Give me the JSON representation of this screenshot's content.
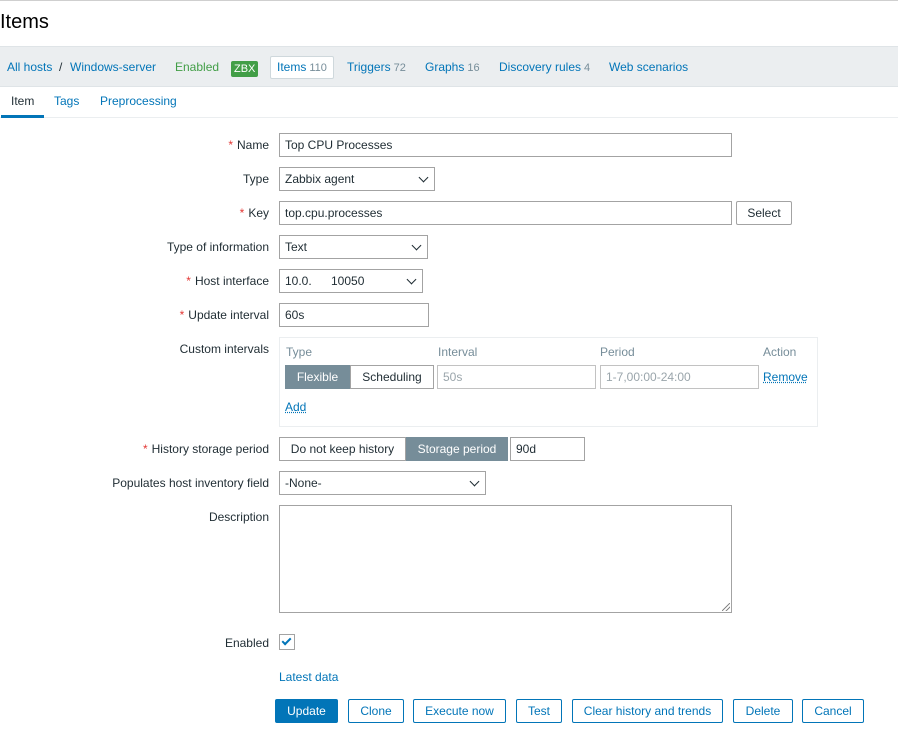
{
  "page": {
    "title": "Items"
  },
  "hostbar": {
    "all_hosts": "All hosts",
    "separator": "/",
    "host": "Windows-server",
    "status": "Enabled",
    "zbx_badge": "ZBX",
    "items_label": "Items",
    "items_count": "110",
    "triggers_label": "Triggers",
    "triggers_count": "72",
    "graphs_label": "Graphs",
    "graphs_count": "16",
    "discovery_label": "Discovery rules",
    "discovery_count": "4",
    "web_label": "Web scenarios"
  },
  "tabs": [
    {
      "label": "Item",
      "active": true
    },
    {
      "label": "Tags",
      "active": false
    },
    {
      "label": "Preprocessing",
      "active": false
    }
  ],
  "form": {
    "name": {
      "label": "Name",
      "value": "Top CPU Processes"
    },
    "type": {
      "label": "Type",
      "value": "Zabbix agent"
    },
    "key": {
      "label": "Key",
      "value": "top.cpu.processes",
      "select_button": "Select"
    },
    "type_info": {
      "label": "Type of information",
      "value": "Text"
    },
    "host_interface": {
      "label": "Host interface",
      "ip": "10.0.",
      "port": "10050"
    },
    "update_interval": {
      "label": "Update interval",
      "value": "60s"
    },
    "custom_intervals": {
      "label": "Custom intervals",
      "columns": {
        "type": "Type",
        "interval": "Interval",
        "period": "Period",
        "action": "Action"
      },
      "row": {
        "flexible": "Flexible",
        "scheduling": "Scheduling",
        "interval_placeholder": "50s",
        "period_placeholder": "1-7,00:00-24:00",
        "remove": "Remove"
      },
      "add": "Add"
    },
    "history": {
      "label": "History storage period",
      "do_not_keep": "Do not keep history",
      "storage_period": "Storage period",
      "value": "90d"
    },
    "inventory": {
      "label": "Populates host inventory field",
      "value": "-None-"
    },
    "description": {
      "label": "Description",
      "value": ""
    },
    "enabled": {
      "label": "Enabled",
      "checked": true
    },
    "latest_data": "Latest data"
  },
  "buttons": {
    "update": "Update",
    "clone": "Clone",
    "execute_now": "Execute now",
    "test": "Test",
    "clear_history": "Clear history and trends",
    "delete": "Delete",
    "cancel": "Cancel"
  },
  "colors": {
    "accent": "#0275b8",
    "enabled": "#429e47",
    "required": "#e33734",
    "segment_active": "#768d99"
  }
}
